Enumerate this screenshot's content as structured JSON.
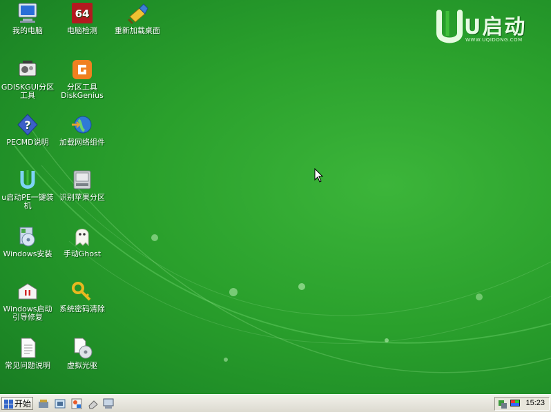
{
  "desktop": {
    "brand": {
      "name": "U启动",
      "url": "WWW.UQIDONG.COM"
    },
    "icons": [
      {
        "label": "我的电脑",
        "icon": "my-computer-icon"
      },
      {
        "label": "电脑检测",
        "icon": "hardware-test-64-icon",
        "badge": "64"
      },
      {
        "label": "重新加载桌面",
        "icon": "reload-desktop-icon"
      },
      {
        "label": "GDISKGUI分区工具",
        "icon": "gdisk-partition-icon"
      },
      {
        "label": "分区工具DiskGenius",
        "icon": "diskgenius-icon"
      },
      {
        "label": "PECMD说明",
        "icon": "help-icon"
      },
      {
        "label": "加载网络组件",
        "icon": "network-globe-icon"
      },
      {
        "label": "u启动PE一键装机",
        "icon": "uqidong-logo-icon"
      },
      {
        "label": "识别苹果分区",
        "icon": "apple-partition-disk-icon"
      },
      {
        "label": "Windows安装",
        "icon": "windows-install-icon"
      },
      {
        "label": "手动Ghost",
        "icon": "ghost-icon"
      },
      {
        "label": "Windows启动引导修复",
        "icon": "boot-repair-kit-icon"
      },
      {
        "label": "系统密码清除",
        "icon": "key-icon"
      },
      {
        "label": "常见问题说明",
        "icon": "document-icon"
      },
      {
        "label": "虚拟光驱",
        "icon": "virtual-cd-icon"
      }
    ]
  },
  "taskbar": {
    "start_label": "开始",
    "quick_launch": [
      "tools-icon",
      "screenshot-icon",
      "image-tool-icon",
      "eraser-icon",
      "computer-icon"
    ],
    "tray_icons": [
      "network-tray-icon",
      "display-tray-icon"
    ],
    "clock": "15:23"
  },
  "colors": {
    "desktop_green": "#2aa02c",
    "taskbar": "#e8e6dc"
  }
}
